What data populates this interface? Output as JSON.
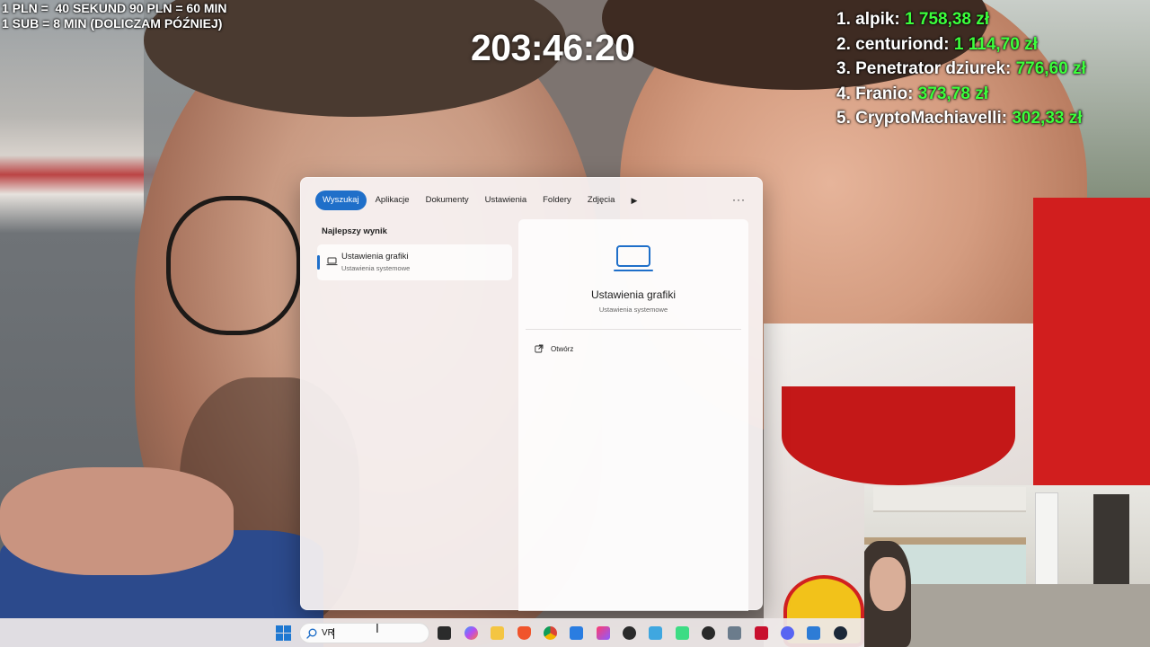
{
  "overlay": {
    "rules_line1": "1 PLN =  40 SEKUND 90 PLN = 60 MIN",
    "rules_line2": "1 SUB = 8 MIN (DOLICZAM PÓŹNIEJ)",
    "timer": "203:46:20",
    "leaderboard": [
      {
        "name": "1. alpik: ",
        "amount": "1 758,38 zł"
      },
      {
        "name": "2. centuriond: ",
        "amount": "1 114,70 zł"
      },
      {
        "name": "3. Penetrator dziurek: ",
        "amount": "776,60 zł"
      },
      {
        "name": "4. Franio: ",
        "amount": "373,78 zł"
      },
      {
        "name": "5. CryptoMachiavelli: ",
        "amount": "302,33 zł"
      }
    ],
    "name_color": "#ffffff",
    "amount_color": "#3cff3c"
  },
  "search_panel": {
    "tabs": [
      "Wyszukaj",
      "Aplikacje",
      "Dokumenty",
      "Ustawienia",
      "Foldery",
      "Zdjęcia"
    ],
    "active_tab": "Wyszukaj",
    "more_label": "···",
    "play_label": "▶",
    "best_match_label": "Najlepszy wynik",
    "result": {
      "title": "Ustawienia grafiki",
      "subtitle": "Ustawienia systemowe",
      "icon": "laptop-icon"
    },
    "detail": {
      "title": "Ustawienia grafiki",
      "subtitle": "Ustawienia systemowe",
      "open_label": "Otwórz",
      "icon": "laptop-icon"
    },
    "accent": "#1f6fc9"
  },
  "taskbar": {
    "search_value": "VR",
    "icons": [
      "windows-start-icon",
      "search-icon",
      "task-view-icon",
      "copilot-icon",
      "file-explorer-icon",
      "brave-icon",
      "chrome-icon",
      "store-icon",
      "app-icon",
      "obs-icon",
      "notepad-icon",
      "android-studio-icon",
      "app-icon-2",
      "calculator-icon",
      "adobe-icon",
      "discord-icon",
      "app-icon-3",
      "steam-icon"
    ]
  }
}
